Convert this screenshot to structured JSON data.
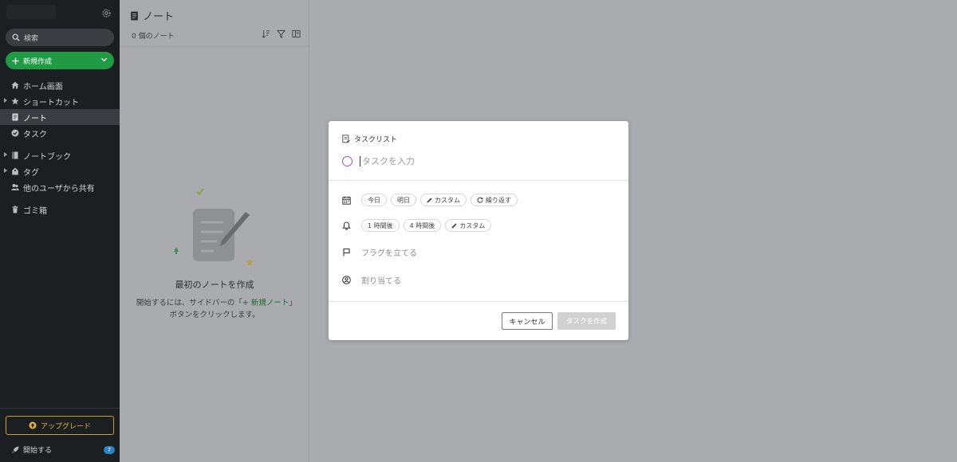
{
  "sidebar": {
    "search_placeholder": "検索",
    "new_button": "新規作成",
    "items": [
      {
        "label": "ホーム画面"
      },
      {
        "label": "ショートカット"
      },
      {
        "label": "ノート"
      },
      {
        "label": "タスク"
      },
      {
        "label": "ノートブック"
      },
      {
        "label": "タグ"
      },
      {
        "label": "他のユーザから共有"
      },
      {
        "label": "ゴミ箱"
      }
    ],
    "upgrade_label": "アップグレード",
    "get_started_label": "開始する",
    "get_started_badge": "7"
  },
  "notelist": {
    "title": "ノート",
    "count": "0 個のノート",
    "empty_title": "最初のノートを作成",
    "empty_desc_pre": "開始するには、サイドバーの「",
    "empty_desc_link": "+ 新規ノート",
    "empty_desc_post": "」ボタンをクリックします。"
  },
  "modal": {
    "header": "タスクリスト",
    "task_placeholder": "タスクを入力",
    "due_chips": [
      "今日",
      "明日",
      "カスタム",
      "繰り返す"
    ],
    "reminder_chips": [
      "1 時間後",
      "4 時間後",
      "カスタム"
    ],
    "flag_label": "フラグを立てる",
    "assign_label": "割り当てる",
    "cancel_label": "キャンセル",
    "create_label": "タスクを作成"
  },
  "colors": {
    "sidebar_bg": "#1c1f22",
    "accent_green": "#1e9b43",
    "upgrade_gold": "#e0b634",
    "task_circle": "#a64fc9"
  }
}
